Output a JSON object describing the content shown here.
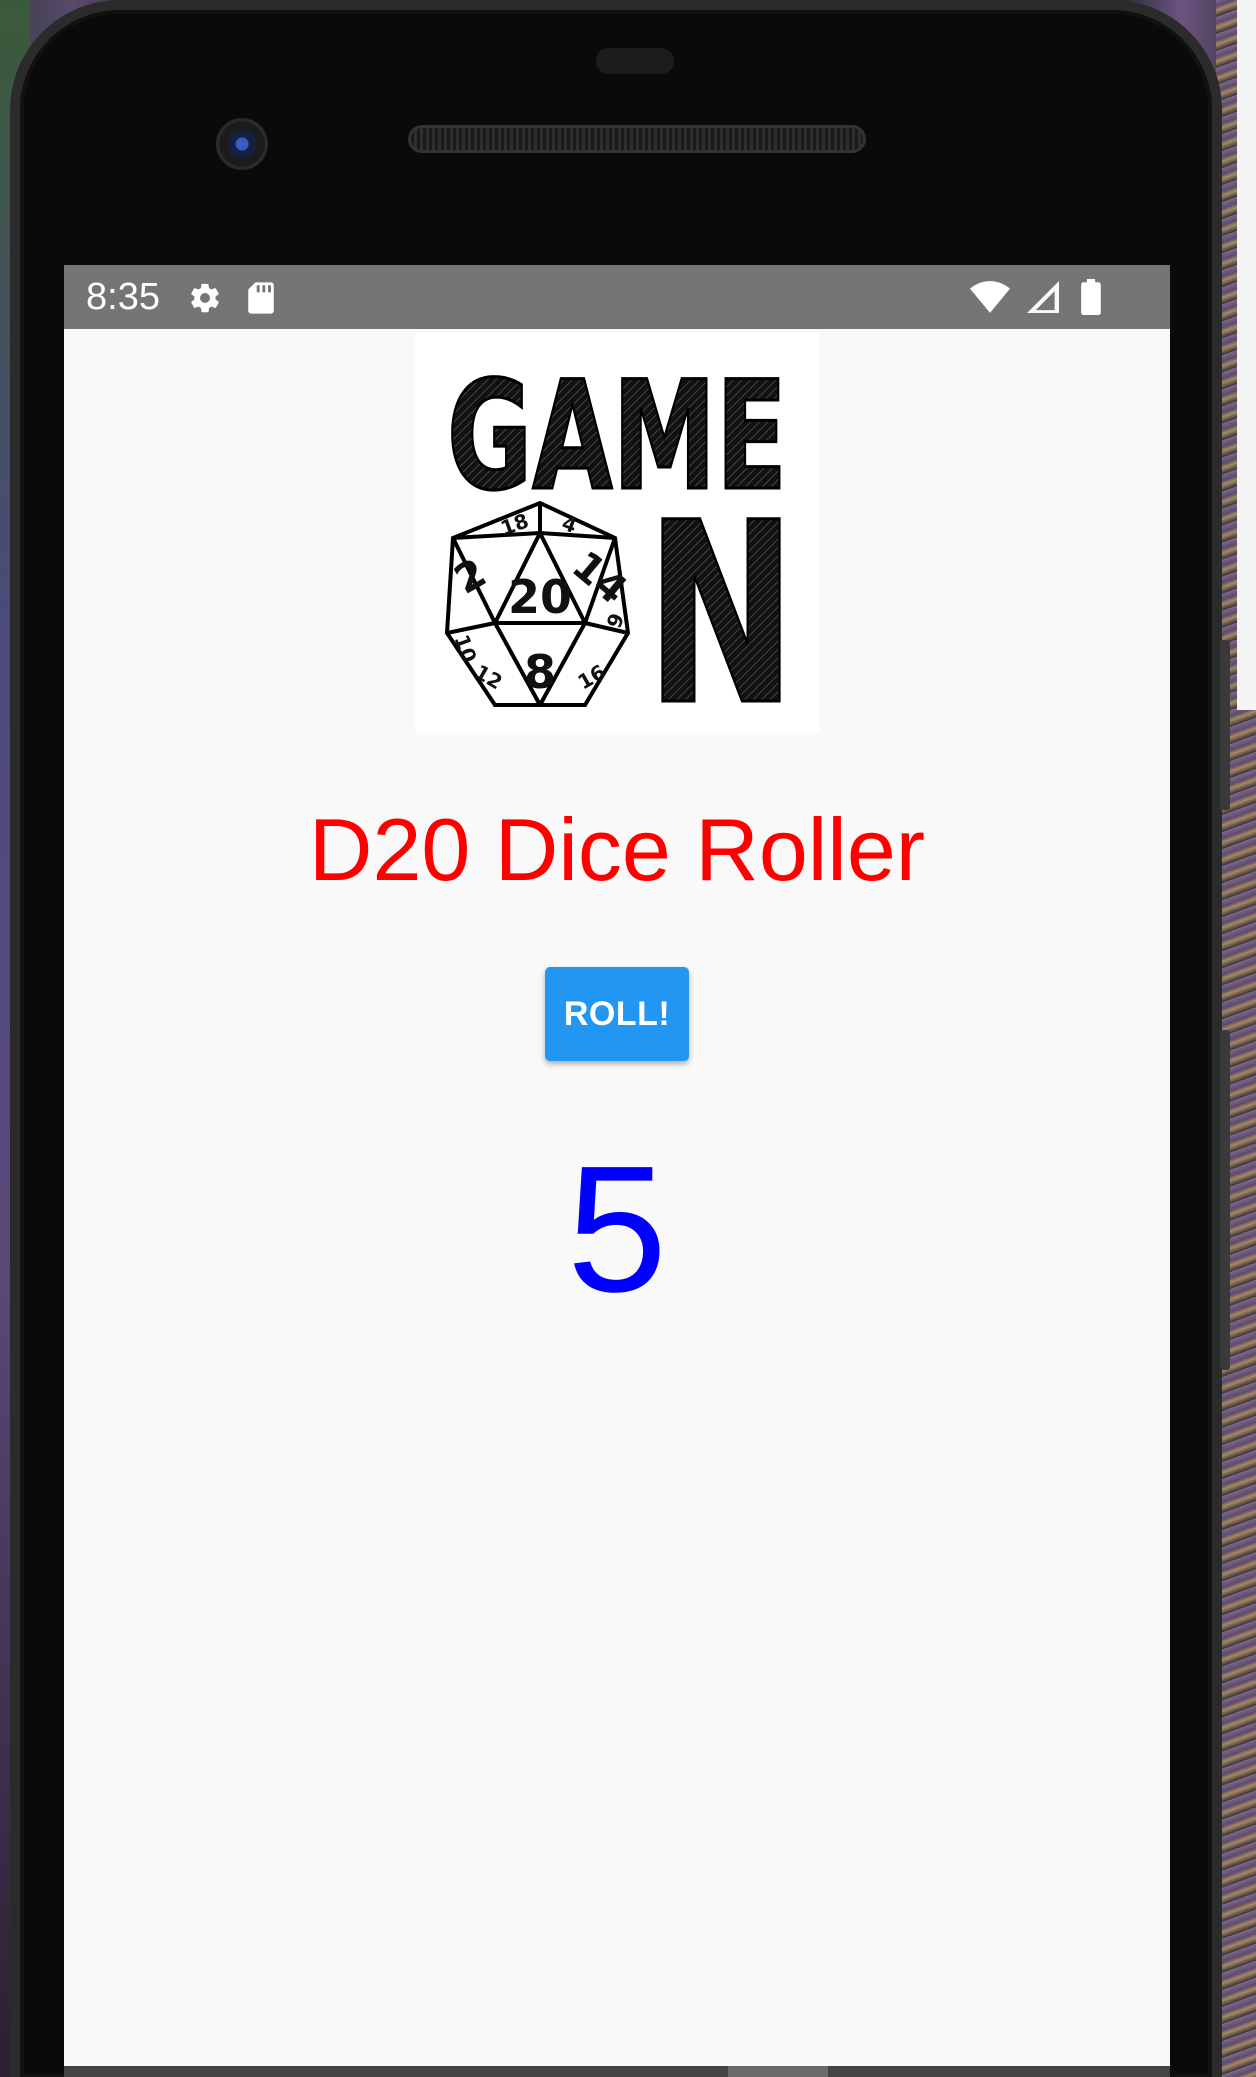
{
  "status_bar": {
    "time": "8:35",
    "left_icons": [
      "settings-icon",
      "sd-card-icon"
    ],
    "right_icons": [
      "wifi-icon",
      "cellular-signal-icon",
      "battery-icon"
    ],
    "background": "#757575"
  },
  "logo": {
    "word_top": "GAME",
    "word_bottom_letter": "N",
    "die_numbers": [
      "20",
      "2",
      "14",
      "8",
      "18",
      "4",
      "10",
      "12",
      "9",
      "16"
    ]
  },
  "app": {
    "title": "D20 Dice Roller",
    "title_color": "#ff0000",
    "roll_button_label": "ROLL!",
    "roll_button_color": "#2196f3",
    "result": "5",
    "result_color": "#0000ff"
  }
}
